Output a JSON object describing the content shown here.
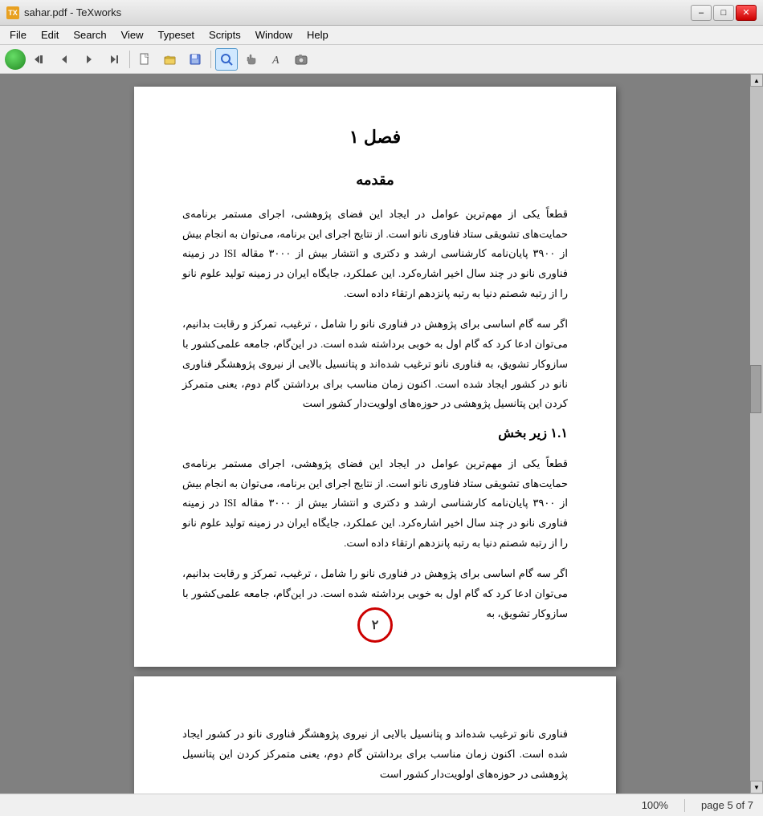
{
  "titlebar": {
    "title": "sahar.pdf - TeXworks",
    "icon_label": "TX",
    "minimize_label": "–",
    "maximize_label": "□",
    "close_label": "✕"
  },
  "menubar": {
    "items": [
      {
        "id": "file",
        "label": "File"
      },
      {
        "id": "edit",
        "label": "Edit"
      },
      {
        "id": "search",
        "label": "Search"
      },
      {
        "id": "view",
        "label": "View"
      },
      {
        "id": "typeset",
        "label": "Typeset"
      },
      {
        "id": "scripts",
        "label": "Scripts"
      },
      {
        "id": "window",
        "label": "Window"
      },
      {
        "id": "help",
        "label": "Help"
      }
    ]
  },
  "toolbar": {
    "buttons": [
      {
        "id": "play",
        "icon": "▶",
        "label": "Run"
      },
      {
        "id": "rewind",
        "icon": "⏮",
        "label": "Rewind"
      },
      {
        "id": "back",
        "icon": "◀",
        "label": "Back"
      },
      {
        "id": "forward",
        "icon": "▶",
        "label": "Forward"
      },
      {
        "id": "end",
        "icon": "⏭",
        "label": "End"
      },
      {
        "id": "new",
        "icon": "📄",
        "label": "New"
      },
      {
        "id": "open",
        "icon": "📂",
        "label": "Open"
      },
      {
        "id": "save",
        "icon": "💾",
        "label": "Save"
      },
      {
        "id": "search",
        "icon": "🔍",
        "label": "Search",
        "active": true
      },
      {
        "id": "hand",
        "icon": "✋",
        "label": "Pan"
      },
      {
        "id": "text",
        "icon": "A",
        "label": "Text"
      },
      {
        "id": "snapshot",
        "icon": "📷",
        "label": "Snapshot"
      }
    ]
  },
  "page1": {
    "chapter": "فصل ۱",
    "section_title": "مقدمه",
    "paragraph1": "قطعاً یکی از مهم‌ترین عوامل در ایجاد این فضای پژوهشی، اجرای مستمر برنامه‌ی حمایت‌های تشویقی ستاد فناوری نانو است. از نتایج اجرای این برنامه، می‌توان به انجام بیش از ۳۹۰۰ پایان‌نامه کارشناسی ارشد و دکتری و انتشار بیش از ۳۰۰۰ مقاله ISI در زمینه فناوری نانو در چند سال اخیر اشاره‌کرد. این عملکرد، جایگاه ایران در زمینه تولید علوم نانو را از رتبه شصتم دنیا به رتبه پانزدهم ارتقاء داده است.",
    "paragraph2": "اگر سه گام اساسی برای پژوهش در فناوری نانو را شامل ، ترغیب، تمرکز و رقابت بدانیم، می‌توان ادعا کرد که گام اول به خوبی برداشته شده است. در این‌گام، جامعه علمی‌کشور با سازوکار تشویق، به فناوری نانو ترغیب شده‌اند و پتانسیل بالایی از نیروی پژوهشگر فناوری نانو در کشور ایجاد شده است. اکنون زمان مناسب برای برداشتن گام دوم، یعنی متمرکز کردن این پتانسیل پژوهشی در حوزه‌های اولویت‌دار کشور است",
    "subsection": "۱.۱  زیر بخش",
    "paragraph3": "قطعاً یکی از مهم‌ترین عوامل در ایجاد این فضای پژوهشی، اجرای مستمر برنامه‌ی حمایت‌های تشویقی ستاد فناوری نانو است. از نتایج اجرای این برنامه، می‌توان به انجام بیش از ۳۹۰۰ پایان‌نامه کارشناسی ارشد و دکتری و انتشار بیش از ۳۰۰۰ مقاله ISI در زمینه فناوری نانو در چند سال اخیر اشاره‌کرد. این عملکرد، جایگاه ایران در زمینه تولید علوم نانو را از رتبه شصتم دنیا به رتبه پانزدهم ارتقاء داده است.",
    "paragraph4": "اگر سه گام اساسی برای پژوهش در فناوری نانو را شامل ، ترغیب، تمرکز و رقابت بدانیم، می‌توان ادعا کرد که گام اول به خوبی برداشته شده است. در این‌گام، جامعه علمی‌کشور با سازوکار تشویق، به",
    "page_number": "۲"
  },
  "page2": {
    "paragraph1": "فناوری نانو ترغیب شده‌اند و پتانسیل بالایی از نیروی پژوهشگر فناوری نانو در کشور ایجاد شده است. اکنون زمان مناسب برای برداشتن گام دوم، یعنی متمرکز کردن این پتانسیل پژوهشی در حوزه‌های اولویت‌دار کشور است"
  },
  "statusbar": {
    "zoom": "100%",
    "page_info": "page 5 of 7"
  }
}
